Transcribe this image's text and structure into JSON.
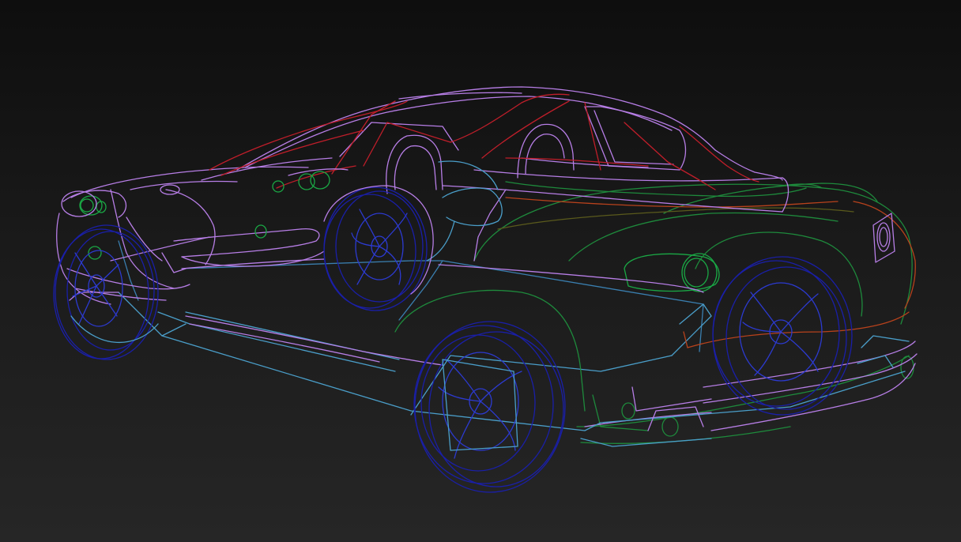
{
  "viewport": {
    "background_top": "#0e0e0e",
    "background_bottom": "#262626"
  },
  "model": {
    "subject": "car-wireframe",
    "colors": {
      "body_outline": "#b77ee6",
      "windows": "#c01e2a",
      "rear_body": "#1e8a3c",
      "lights": "#1aa845",
      "floor_pan": "#4a9ec9",
      "wheels": "#1a1fa8",
      "rear_accent": "#b8421c"
    }
  }
}
